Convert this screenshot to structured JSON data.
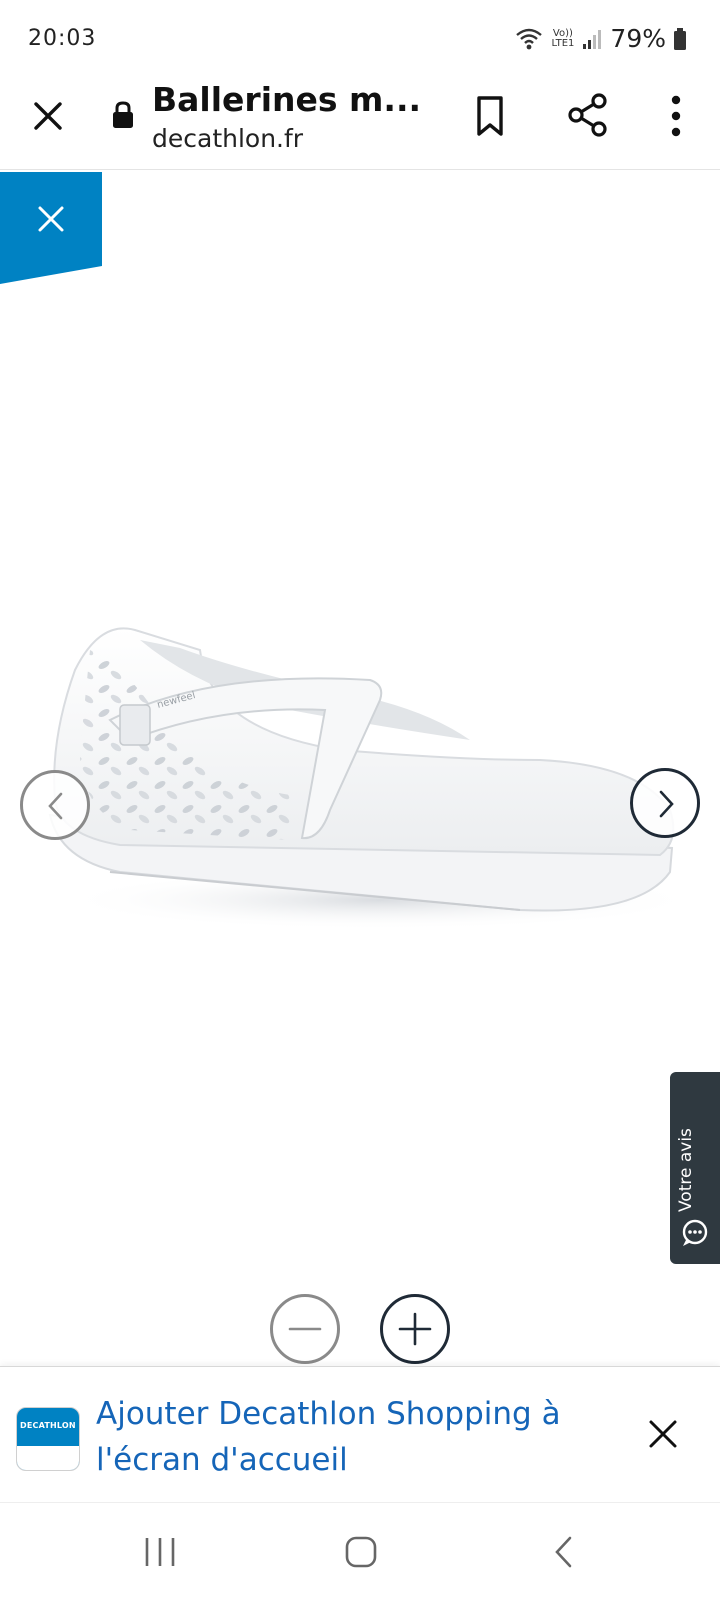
{
  "status_bar": {
    "time": "20:03",
    "net_top": "Vo))",
    "net_bottom": "LTE1",
    "battery": "79%"
  },
  "toolbar": {
    "title": "Ballerines m...",
    "url": "decathlon.fr"
  },
  "feedback": {
    "label": "Votre avis"
  },
  "banner": {
    "logo_text": "DECATHLON",
    "text": "Ajouter Decathlon Shopping à l'écran d'accueil"
  },
  "colors": {
    "accent_blue": "#0082c3",
    "banner_text": "#1565b8",
    "feedback_bg": "#2f3940"
  }
}
